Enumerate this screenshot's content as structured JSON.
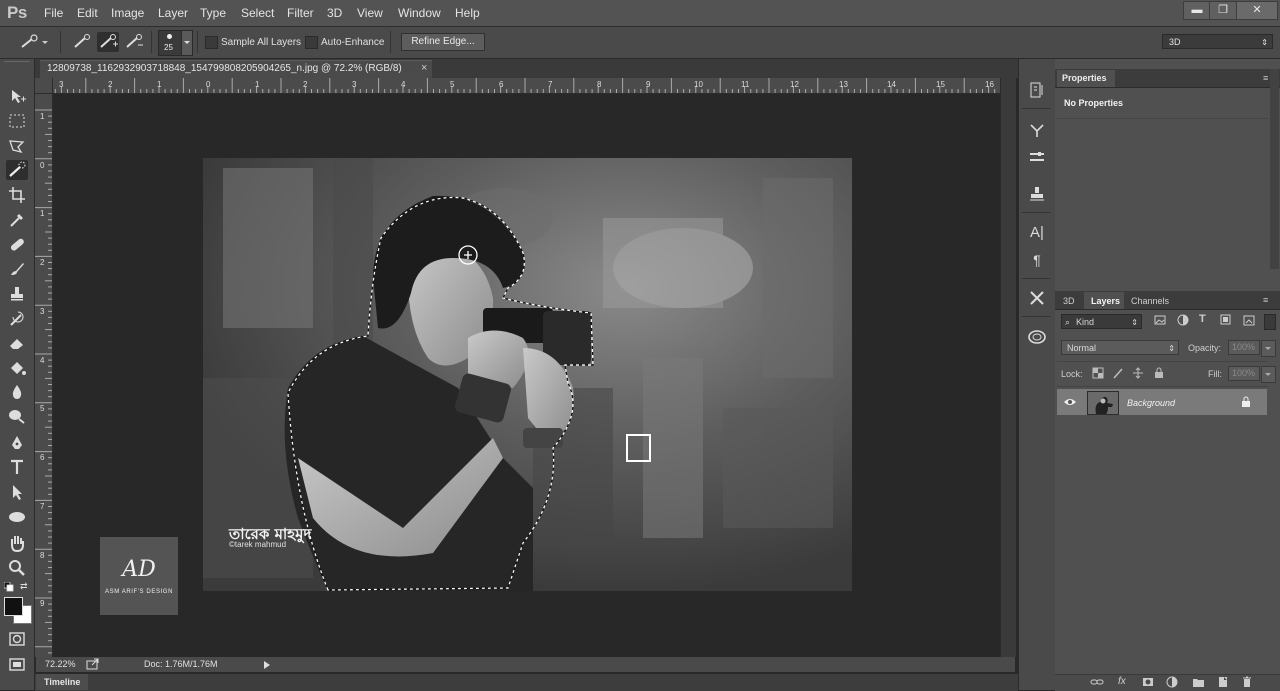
{
  "app": {
    "logo": "Ps"
  },
  "menu": [
    "File",
    "Edit",
    "Image",
    "Layer",
    "Type",
    "Select",
    "Filter",
    "3D",
    "View",
    "Window",
    "Help"
  ],
  "window_controls": {
    "minimize": "▬",
    "restore": "❐",
    "close": "✕"
  },
  "options_bar": {
    "brush_size": "25",
    "sample_all_layers": "Sample All Layers",
    "auto_enhance": "Auto-Enhance",
    "refine_edge": "Refine Edge...",
    "workspace": "3D"
  },
  "document": {
    "tab_title": "12809738_1162932903718848_154799808205904265_n.jpg @ 72.2% (RGB/8)",
    "close": "×",
    "ruler_top": [
      "3",
      "2",
      "1",
      "0",
      "1",
      "2",
      "3",
      "4",
      "5",
      "6",
      "7",
      "8",
      "9",
      "10",
      "11",
      "12",
      "13",
      "14",
      "15",
      "16"
    ],
    "ruler_left": [
      "1",
      "0",
      "1",
      "2",
      "3",
      "4",
      "5",
      "6",
      "7",
      "8",
      "9"
    ],
    "watermark_text": "তারেক মাহমুদ",
    "watermark_sub": "©tarek mahmud"
  },
  "logo_overlay": {
    "mark": "AD",
    "caption": "ASM ARIF'S DESIGN"
  },
  "status": {
    "zoom": "72.22%",
    "doc": "Doc: 1.76M/1.76M"
  },
  "timeline": {
    "label": "Timeline"
  },
  "properties_panel": {
    "tab": "Properties",
    "message": "No Properties"
  },
  "layers_panel": {
    "tabs": [
      "3D",
      "Layers",
      "Channels"
    ],
    "kind": "Kind",
    "blend_mode": "Normal",
    "opacity_label": "Opacity:",
    "opacity_value": "100%",
    "lock_label": "Lock:",
    "fill_label": "Fill:",
    "fill_value": "100%",
    "layers": [
      {
        "name": "Background",
        "visible": true,
        "locked": true
      }
    ]
  },
  "colors": {
    "menu_bg": "#535353",
    "panel_bg": "#4a4a4a",
    "canvas_bg": "#282828",
    "selected_layer": "#7a7a7a"
  }
}
